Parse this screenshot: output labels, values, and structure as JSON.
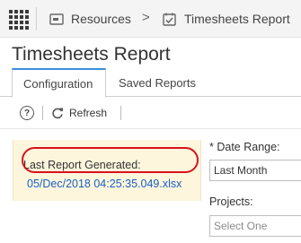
{
  "breadcrumb": {
    "home": "Resources",
    "current": "Timesheets Report",
    "separator": ">"
  },
  "page": {
    "title": "Timesheets Report"
  },
  "tabs": [
    {
      "label": "Configuration",
      "active": true
    },
    {
      "label": "Saved Reports",
      "active": false
    }
  ],
  "toolbar": {
    "help_label": "?",
    "refresh_label": "Refresh"
  },
  "report": {
    "label": "Last Report Generated:",
    "link": "05/Dec/2018 04:25:35.049.xlsx"
  },
  "form": {
    "date_range_label": "* Date Range:",
    "date_range_value": "Last Month",
    "projects_label": "Projects:",
    "projects_placeholder": "Select One"
  },
  "colors": {
    "accent": "#3b8fd9",
    "link": "#1a5fc4",
    "highlight": "#d9121b",
    "panel_bg": "#fdf6dd"
  },
  "icons": {
    "apps": "apps-grid-icon",
    "home": "folder-icon",
    "timesheets": "calendar-check-icon",
    "help": "help-icon",
    "refresh": "refresh-icon"
  }
}
